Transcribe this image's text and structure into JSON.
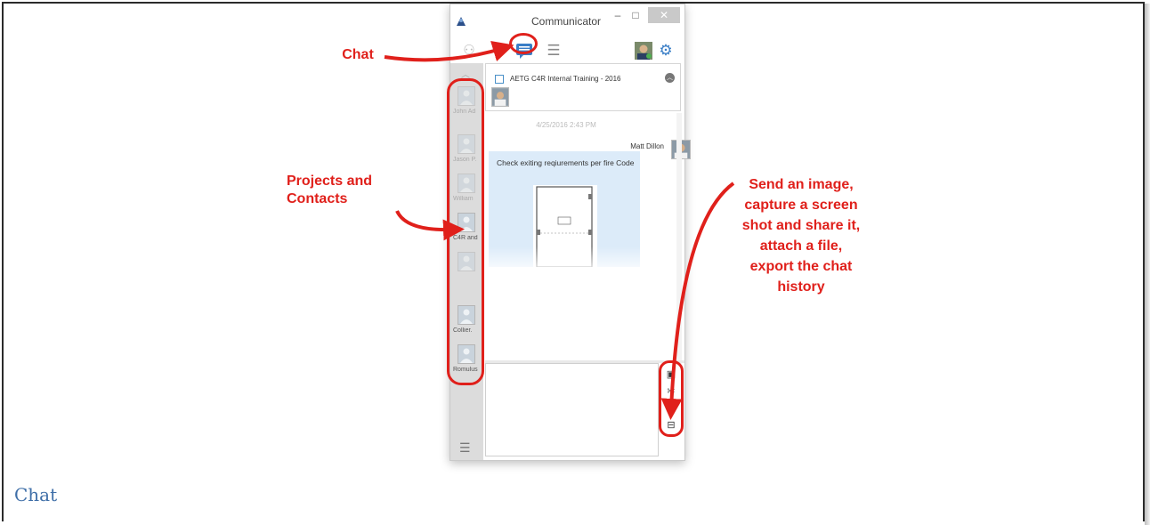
{
  "window": {
    "title": "Communicator",
    "buttons": {
      "minimize": "–",
      "maximize": "□",
      "close": "✕"
    }
  },
  "toolbar": {
    "chat_icon": "chat-bubble-icon",
    "list_icon": "list-icon",
    "people_icon": "people-icon",
    "settings_icon": "gear-icon"
  },
  "sidebar": {
    "contacts": [
      {
        "name": "John Ad",
        "faded": true
      },
      {
        "name": "Jason P.",
        "faded": true
      },
      {
        "name": "William",
        "faded": true
      },
      {
        "name": "C4R and",
        "faded": false
      },
      {
        "name": "",
        "faded": true
      },
      {
        "name": "",
        "faded": true
      },
      {
        "name": "Collier.",
        "faded": false
      },
      {
        "name": "Romulus",
        "faded": false
      }
    ]
  },
  "project": {
    "title": "AETG C4R Internal Training - 2016"
  },
  "conversation": {
    "timestamp": "4/25/2016 2:43 PM",
    "sender": "Matt Dillon",
    "message": "Check exiting reqiurements per fire Code"
  },
  "compose_actions": [
    {
      "name": "send-image-icon",
      "glyph": "▣"
    },
    {
      "name": "screenshot-icon",
      "glyph": "✂"
    },
    {
      "name": "attach-file-icon",
      "glyph": "⌀"
    },
    {
      "name": "export-history-icon",
      "glyph": "⊟"
    }
  ],
  "annotations": {
    "chat": "Chat",
    "projects_contacts": "Projects and\nContacts",
    "actions": "Send an image,\ncapture a screen\nshot and share it,\nattach a file,\nexport the chat\nhistory"
  },
  "caption": "Chat",
  "colors": {
    "annotation": "#e0201b",
    "caption": "#3f6fa8",
    "accent": "#3a7ec6",
    "bubble": "#dcebf9"
  }
}
